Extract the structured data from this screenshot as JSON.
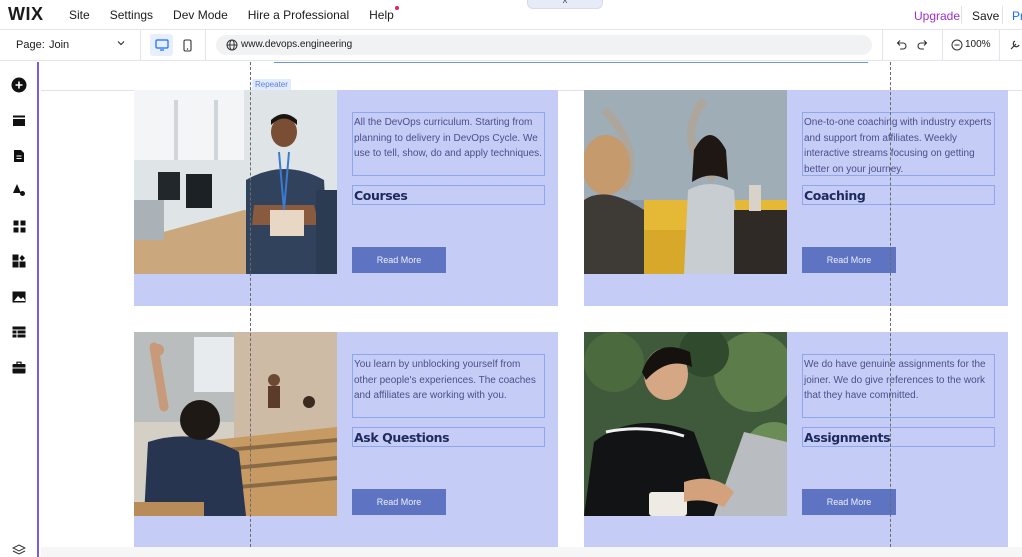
{
  "topbar": {
    "logo": "WIX",
    "menu": [
      "Site",
      "Settings",
      "Dev Mode",
      "Hire a Professional",
      "Help"
    ],
    "upgrade": "Upgrade",
    "save": "Save",
    "preview": "Pr",
    "collapse_glyph": "^"
  },
  "toolbar": {
    "page_label": "Page:",
    "page_name": "Join",
    "url": "www.devops.engineering",
    "zoom": "100%"
  },
  "sidebar": {
    "icons": [
      "add-icon",
      "sections-icon",
      "pages-icon",
      "design-icon",
      "apps-icon",
      "business-icon",
      "media-icon",
      "cms-icon",
      "portfolio-icon",
      "layers-icon"
    ]
  },
  "canvas": {
    "repeater_tag": "Repeater",
    "cards": [
      {
        "description": "All the DevOps curriculum. Starting from planning to delivery in DevOps Cycle. We use to tell, show, do and apply techniques.",
        "title": "Courses",
        "button": "Read More"
      },
      {
        "description": "One-to-one coaching with industry experts and support from affiliates. Weekly interactive streams focusing on getting better on your journey.",
        "title": "Coaching",
        "button": "Read More"
      },
      {
        "description": "You learn by unblocking yourself from other people's experiences. The coaches and affiliates are working with you.",
        "title": "Ask Questions",
        "button": "Read More"
      },
      {
        "description": "We do have genuine assignments for the joiner. We do give references to the work that they have committed.",
        "title": "Assignments",
        "button": "Read More"
      }
    ]
  },
  "colors": {
    "card_bg": "#c5cdf6",
    "button_bg": "#5e73c2",
    "accent_purple": "#7a5ce8",
    "upgrade": "#9c2fd4"
  }
}
